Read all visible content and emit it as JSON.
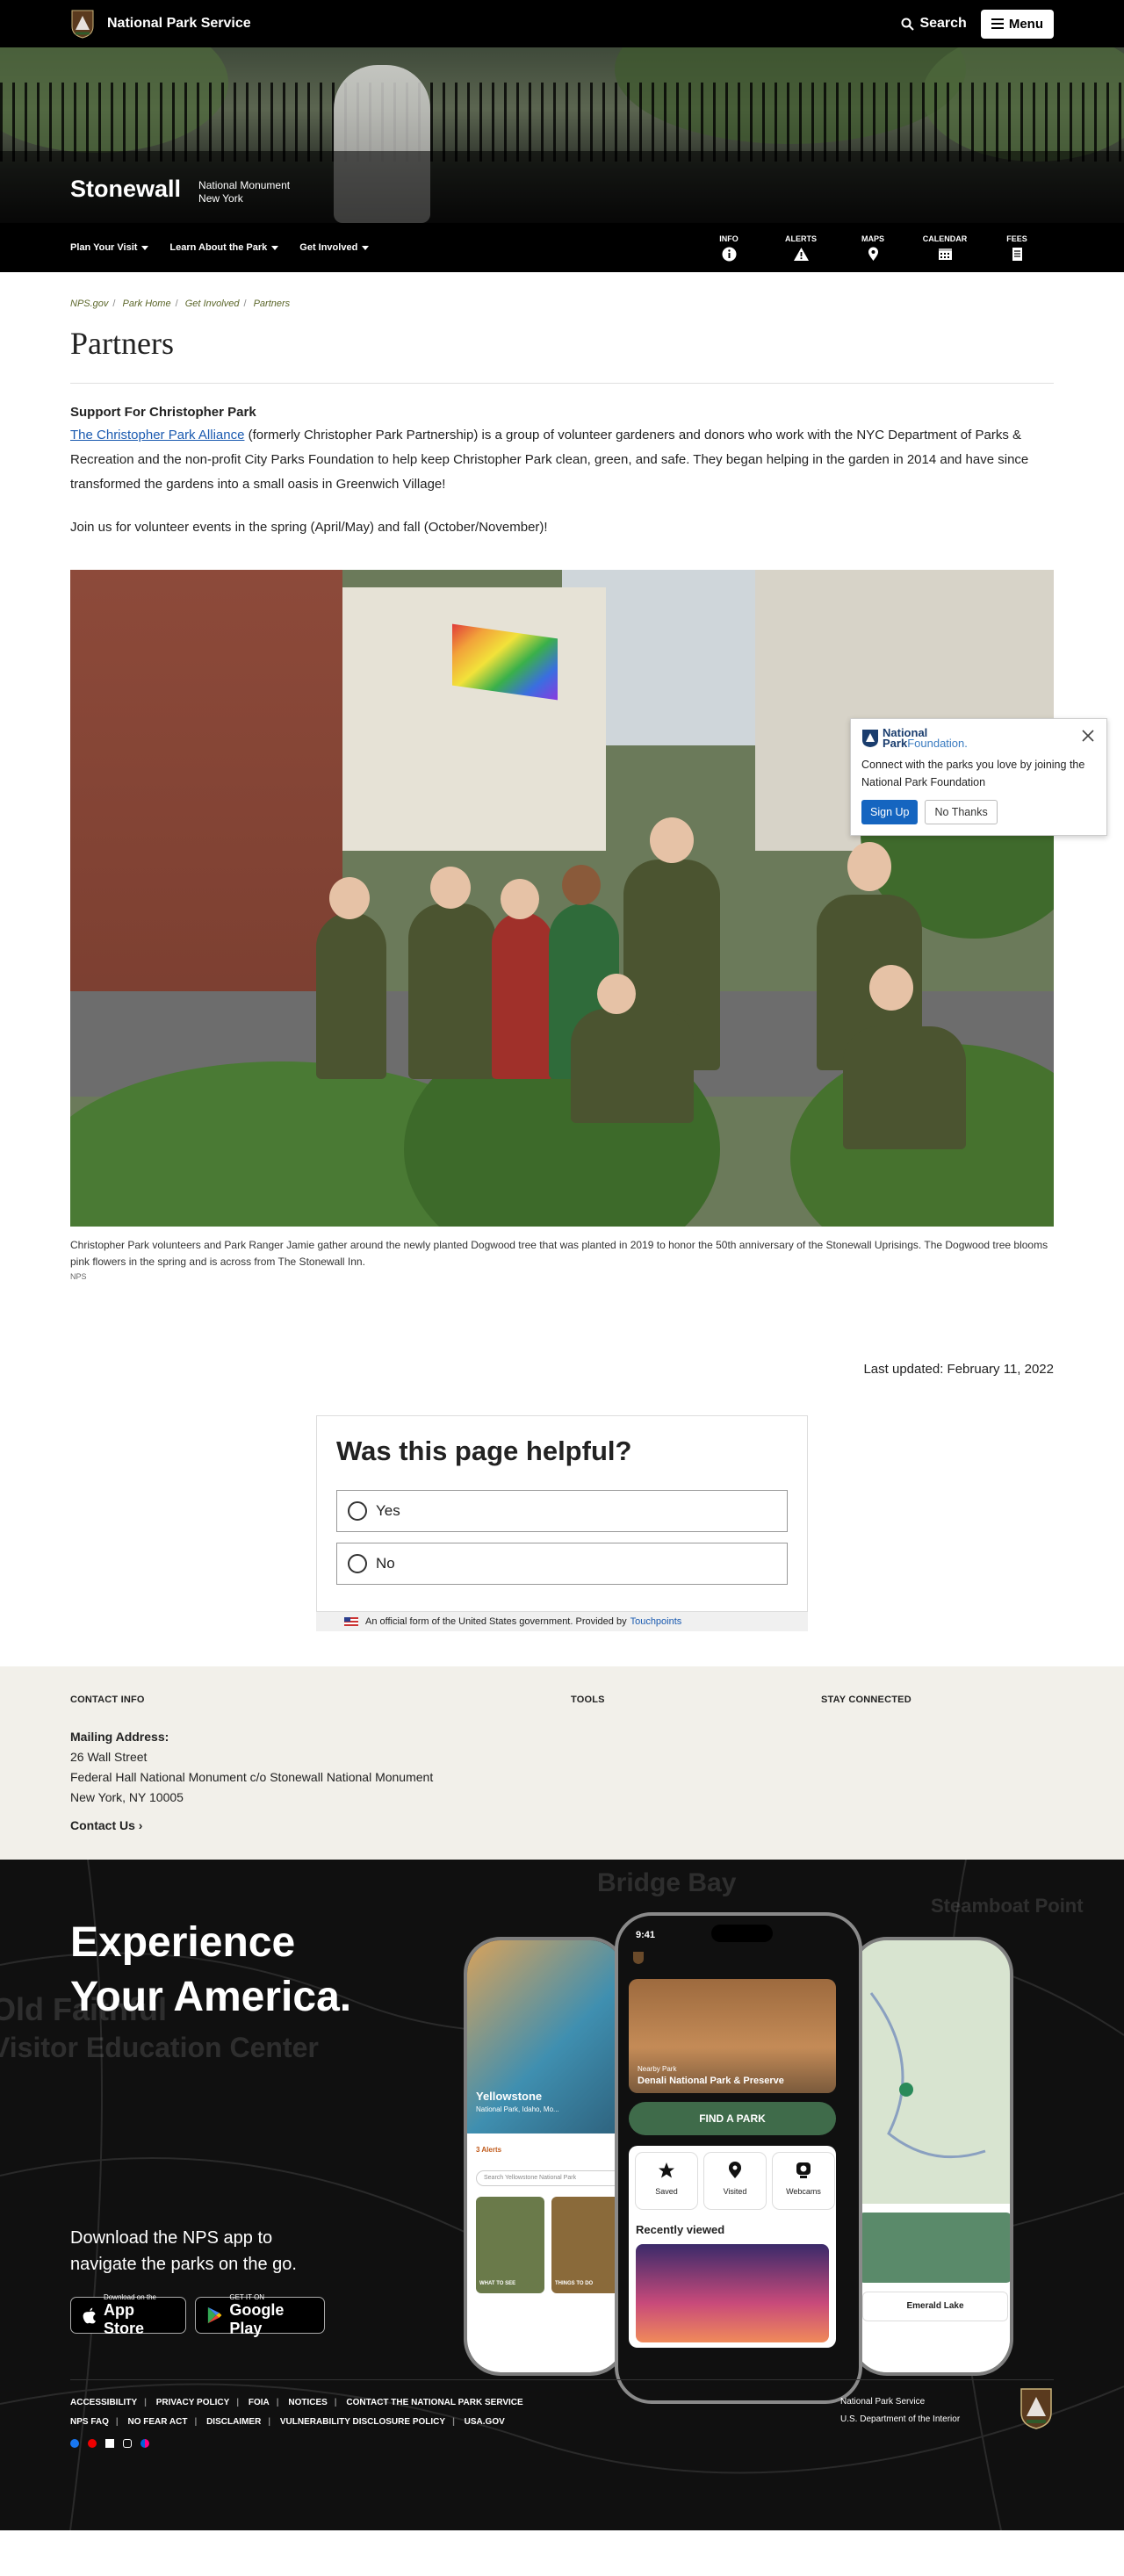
{
  "header": {
    "brand": "National Park Service",
    "search_label": "Search",
    "menu_label": "Menu"
  },
  "hero": {
    "park_name": "Stonewall",
    "designation": "National Monument",
    "state": "New York"
  },
  "subnav": {
    "items": [
      {
        "label": "Plan Your Visit"
      },
      {
        "label": "Learn About the Park"
      },
      {
        "label": "Get Involved"
      }
    ],
    "quick": [
      {
        "label": "INFO",
        "icon": "info-icon"
      },
      {
        "label": "ALERTS",
        "icon": "alert-icon"
      },
      {
        "label": "MAPS",
        "icon": "map-pin-icon"
      },
      {
        "label": "CALENDAR",
        "icon": "calendar-icon"
      },
      {
        "label": "FEES",
        "icon": "fees-icon"
      }
    ]
  },
  "breadcrumb": [
    "NPS.gov",
    "Park Home",
    "Get Involved",
    "Partners"
  ],
  "page": {
    "title": "Partners",
    "section_heading": "Support For Christopher Park",
    "link_text": "The Christopher Park Alliance",
    "paragraph_rest": " (formerly Christopher Park Partnership) is a group of volunteer gardeners and donors who work with the NYC Department of Parks & Recreation and the non-profit City Parks Foundation to help keep Christopher Park clean, green, and safe. They began helping in the garden in 2014 and have since transformed the gardens into a small oasis in Greenwich Village!",
    "join_text": "Join us for volunteer events in the spring (April/May) and fall (October/November)!",
    "caption": "Christopher Park volunteers and Park Ranger Jamie gather around the newly planted Dogwood tree that was planted in 2019 to honor the 50th anniversary of the Stonewall Uprisings. The Dogwood tree blooms pink flowers in the spring and is across from The Stonewall Inn.",
    "credit": "NPS",
    "last_updated": "Last updated: February 11, 2022"
  },
  "popup": {
    "logo_line1": "National",
    "logo_line2": "Park",
    "logo_line2b": "Foundation.",
    "text": "Connect with the parks you love by joining the National Park Foundation",
    "signup": "Sign Up",
    "nothanks": "No Thanks"
  },
  "feedback": {
    "question": "Was this page helpful?",
    "yes": "Yes",
    "no": "No",
    "official": "An official form of the United States government. Provided by",
    "provider": "Touchpoints"
  },
  "contact": {
    "col1_title": "CONTACT INFO",
    "col2_title": "TOOLS",
    "col3_title": "STAY CONNECTED",
    "mailing_heading": "Mailing Address:",
    "address_lines": [
      "26 Wall Street",
      "Federal Hall National Monument c/o Stonewall National Monument",
      "New York, NY 10005"
    ],
    "contact_us": "Contact Us"
  },
  "promo": {
    "headline_line1": "Experience",
    "headline_line2": "Your America.",
    "download_line1": "Download the NPS app to",
    "download_line2": "navigate the parks on the go.",
    "appstore_small": "Download on the",
    "appstore_big": "App Store",
    "play_small": "GET IT ON",
    "play_big": "Google Play",
    "phone": {
      "time": "9:41",
      "nearby_label": "Nearby Park",
      "nearby_park": "Denali National Park & Preserve",
      "find_button": "FIND A PARK",
      "tiles": [
        "Saved",
        "Visited",
        "Webcams"
      ],
      "recently_viewed": "Recently viewed",
      "left_title": "Yellowstone",
      "left_sub": "National Park, Idaho, Mo...",
      "left_alerts": "3 Alerts",
      "left_search": "Search Yellowstone National Park",
      "left_tiles": [
        "WHAT TO SEE",
        "THINGS TO DO"
      ],
      "right_place": "Emerald Lake"
    }
  },
  "footer": {
    "links_row1": [
      "ACCESSIBILITY",
      "PRIVACY POLICY",
      "FOIA",
      "NOTICES",
      "CONTACT THE NATIONAL PARK SERVICE"
    ],
    "links_row2": [
      "NPS FAQ",
      "NO FEAR ACT",
      "DISCLAIMER",
      "VULNERABILITY DISCLOSURE POLICY",
      "USA.GOV"
    ],
    "agency_line1": "National Park Service",
    "agency_line2": "U.S. Department of the Interior"
  },
  "colors": {
    "link": "#1a5ab0",
    "breadcrumb": "#5b6629",
    "signup": "#1565c0",
    "find_button": "#3f6b4a"
  }
}
